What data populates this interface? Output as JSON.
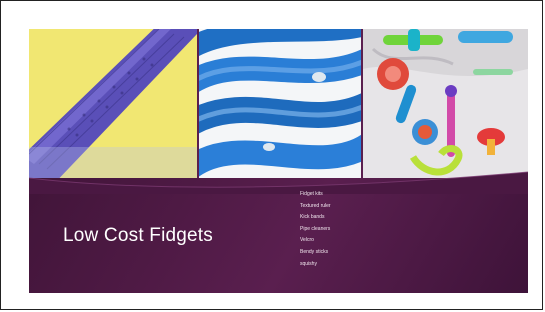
{
  "slide": {
    "title": "Low Cost Fidgets",
    "bullets": [
      "Fidget kits",
      "Textured ruler",
      "Kick bands",
      "Pipe cleaners",
      "Velcro",
      "Bendy sticks",
      "squishy"
    ],
    "images": [
      {
        "name": "textured-tube-photo"
      },
      {
        "name": "blue-coil-photo"
      },
      {
        "name": "fidget-toys-photo"
      }
    ]
  },
  "colors": {
    "background_top": "#3a1233",
    "background_mid": "#5a1f4f",
    "title_text": "#ffffff",
    "bullet_text": "#f1e6ee"
  }
}
